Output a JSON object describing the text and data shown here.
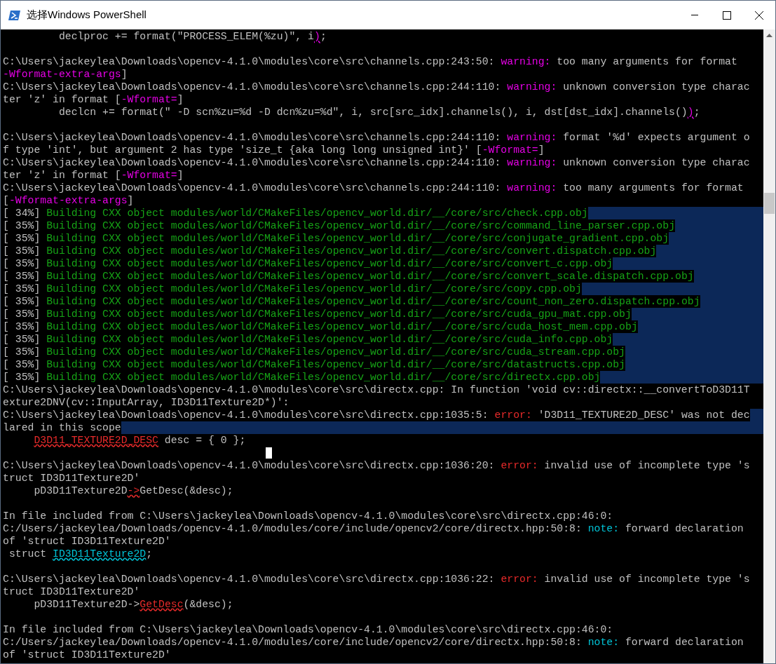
{
  "window": {
    "title": "选择Windows PowerShell"
  },
  "lines": [
    {
      "selected": false,
      "segments": [
        {
          "text": "         declproc += format(\"PROCESS_ELEM(%zu)\", i",
          "kind": "plain"
        },
        {
          "text": ")",
          "kind": "warn_mark"
        },
        {
          "text": ";",
          "kind": "plain"
        }
      ]
    },
    {
      "selected": false
    },
    {
      "selected": false,
      "segments": [
        {
          "text": "C:\\Users\\jackeylea\\Downloads\\opencv-4.1.0\\modules\\core\\src\\channels.cpp:243:50: ",
          "kind": "plain"
        },
        {
          "text": "warning:",
          "kind": "warning"
        },
        {
          "text": " too many arguments for format",
          "kind": "plain"
        }
      ]
    },
    {
      "selected": false,
      "segments": [
        {
          "text": "-Wformat-extra-args",
          "kind": "warning"
        },
        {
          "text": "]",
          "kind": "plain"
        }
      ]
    },
    {
      "selected": false,
      "segments": [
        {
          "text": "C:\\Users\\jackeylea\\Downloads\\opencv-4.1.0\\modules\\core\\src\\channels.cpp:244:110: ",
          "kind": "plain"
        },
        {
          "text": "warning:",
          "kind": "warning"
        },
        {
          "text": " unknown conversion type charac",
          "kind": "plain"
        }
      ]
    },
    {
      "selected": false,
      "segments": [
        {
          "text": "ter 'z' in format [",
          "kind": "plain"
        },
        {
          "text": "-Wformat=",
          "kind": "warning"
        },
        {
          "text": "]",
          "kind": "plain"
        }
      ]
    },
    {
      "selected": false,
      "segments": [
        {
          "text": "         declcn += format(\" -D scn%zu=%d -D dcn%zu=%d\", i, src[src_idx].channels(), i, dst[dst_idx].channels()",
          "kind": "plain"
        },
        {
          "text": ")",
          "kind": "warn_mark"
        },
        {
          "text": ";",
          "kind": "plain"
        }
      ]
    },
    {
      "selected": false
    },
    {
      "selected": false,
      "segments": [
        {
          "text": "C:\\Users\\jackeylea\\Downloads\\opencv-4.1.0\\modules\\core\\src\\channels.cpp:244:110: ",
          "kind": "plain"
        },
        {
          "text": "warning:",
          "kind": "warning"
        },
        {
          "text": " format '%d' expects argument o",
          "kind": "plain"
        }
      ]
    },
    {
      "selected": false,
      "segments": [
        {
          "text": "f type 'int', but argument 2 has type 'size_t {aka long long unsigned int}' [",
          "kind": "plain"
        },
        {
          "text": "-Wformat=",
          "kind": "warning"
        },
        {
          "text": "]",
          "kind": "plain"
        }
      ]
    },
    {
      "selected": false,
      "segments": [
        {
          "text": "C:\\Users\\jackeylea\\Downloads\\opencv-4.1.0\\modules\\core\\src\\channels.cpp:244:110: ",
          "kind": "plain"
        },
        {
          "text": "warning:",
          "kind": "warning"
        },
        {
          "text": " unknown conversion type charac",
          "kind": "plain"
        }
      ]
    },
    {
      "selected": false,
      "segments": [
        {
          "text": "ter 'z' in format [",
          "kind": "plain"
        },
        {
          "text": "-Wformat=",
          "kind": "warning"
        },
        {
          "text": "]",
          "kind": "plain"
        }
      ]
    },
    {
      "selected": false,
      "segments": [
        {
          "text": "C:\\Users\\jackeylea\\Downloads\\opencv-4.1.0\\modules\\core\\src\\channels.cpp:244:110: ",
          "kind": "plain"
        },
        {
          "text": "warning:",
          "kind": "warning"
        },
        {
          "text": " too many arguments for format",
          "kind": "plain"
        }
      ]
    },
    {
      "selected": false,
      "segments": [
        {
          "text": "[",
          "kind": "plain"
        },
        {
          "text": "-Wformat-extra-args",
          "kind": "warning"
        },
        {
          "text": "]",
          "kind": "plain"
        }
      ]
    },
    {
      "selected": true,
      "segments": [
        {
          "text": "[ 34%] ",
          "kind": "plain"
        },
        {
          "text": "Building CXX object modules/world/CMakeFiles/opencv_world.dir/__/core/src/check.cpp.obj",
          "kind": "build"
        }
      ]
    },
    {
      "selected": true,
      "segments": [
        {
          "text": "[ 35%] ",
          "kind": "plain"
        },
        {
          "text": "Building CXX object modules/world/CMakeFiles/opencv_world.dir/__/core/src/command_line_parser.cpp.obj",
          "kind": "build"
        }
      ]
    },
    {
      "selected": true,
      "segments": [
        {
          "text": "[ 35%] ",
          "kind": "plain"
        },
        {
          "text": "Building CXX object modules/world/CMakeFiles/opencv_world.dir/__/core/src/conjugate_gradient.cpp.obj",
          "kind": "build"
        }
      ]
    },
    {
      "selected": true,
      "segments": [
        {
          "text": "[ 35%] ",
          "kind": "plain"
        },
        {
          "text": "Building CXX object modules/world/CMakeFiles/opencv_world.dir/__/core/src/convert.dispatch.cpp.obj",
          "kind": "build"
        }
      ]
    },
    {
      "selected": true,
      "segments": [
        {
          "text": "[ 35%] ",
          "kind": "plain"
        },
        {
          "text": "Building CXX object modules/world/CMakeFiles/opencv_world.dir/__/core/src/convert_c.cpp.obj",
          "kind": "build"
        }
      ]
    },
    {
      "selected": true,
      "segments": [
        {
          "text": "[ 35%] ",
          "kind": "plain"
        },
        {
          "text": "Building CXX object modules/world/CMakeFiles/opencv_world.dir/__/core/src/convert_scale.dispatch.cpp.obj",
          "kind": "build"
        }
      ]
    },
    {
      "selected": true,
      "segments": [
        {
          "text": "[ 35%] ",
          "kind": "plain"
        },
        {
          "text": "Building CXX object modules/world/CMakeFiles/opencv_world.dir/__/core/src/copy.cpp.obj",
          "kind": "build"
        }
      ]
    },
    {
      "selected": true,
      "segments": [
        {
          "text": "[ 35%] ",
          "kind": "plain"
        },
        {
          "text": "Building CXX object modules/world/CMakeFiles/opencv_world.dir/__/core/src/count_non_zero.dispatch.cpp.obj",
          "kind": "build"
        }
      ]
    },
    {
      "selected": true,
      "segments": [
        {
          "text": "[ 35%] ",
          "kind": "plain"
        },
        {
          "text": "Building CXX object modules/world/CMakeFiles/opencv_world.dir/__/core/src/cuda_gpu_mat.cpp.obj",
          "kind": "build"
        }
      ]
    },
    {
      "selected": true,
      "segments": [
        {
          "text": "[ 35%] ",
          "kind": "plain"
        },
        {
          "text": "Building CXX object modules/world/CMakeFiles/opencv_world.dir/__/core/src/cuda_host_mem.cpp.obj",
          "kind": "build"
        }
      ]
    },
    {
      "selected": true,
      "segments": [
        {
          "text": "[ 35%] ",
          "kind": "plain"
        },
        {
          "text": "Building CXX object modules/world/CMakeFiles/opencv_world.dir/__/core/src/cuda_info.cpp.obj",
          "kind": "build"
        }
      ]
    },
    {
      "selected": true,
      "segments": [
        {
          "text": "[ 35%] ",
          "kind": "plain"
        },
        {
          "text": "Building CXX object modules/world/CMakeFiles/opencv_world.dir/__/core/src/cuda_stream.cpp.obj",
          "kind": "build"
        }
      ]
    },
    {
      "selected": true,
      "segments": [
        {
          "text": "[ 35%] ",
          "kind": "plain"
        },
        {
          "text": "Building CXX object modules/world/CMakeFiles/opencv_world.dir/__/core/src/datastructs.cpp.obj",
          "kind": "build"
        }
      ]
    },
    {
      "selected": true,
      "segments": [
        {
          "text": "[ 35%] ",
          "kind": "plain"
        },
        {
          "text": "Building CXX object modules/world/CMakeFiles/opencv_world.dir/__/core/src/directx.cpp.obj",
          "kind": "build"
        }
      ]
    },
    {
      "selected": false,
      "segments": [
        {
          "text": "C:\\Users\\jackeylea\\Downloads\\opencv-4.1.0\\modules\\core\\src\\directx.cpp: In function 'void cv::directx::__convertToD3D11T",
          "kind": "plain"
        }
      ]
    },
    {
      "selected": false,
      "segments": [
        {
          "text": "exture2DNV(cv::InputArray, ID3D11Texture2D*)':",
          "kind": "plain"
        }
      ]
    },
    {
      "selected": true,
      "segments": [
        {
          "text": "C:\\Users\\jackeylea\\Downloads\\opencv-4.1.0\\modules\\core\\src\\directx.cpp:1035:5: ",
          "kind": "plain"
        },
        {
          "text": "error:",
          "kind": "error"
        },
        {
          "text": " 'D3D11_TEXTURE2D_DESC' was not dec",
          "kind": "plain"
        }
      ]
    },
    {
      "selected": true,
      "segments": [
        {
          "text": "lared in this scope",
          "kind": "plain"
        }
      ]
    },
    {
      "selected": false,
      "indented": true,
      "segments": [
        {
          "text": "D3D11_TEXTURE2D_DESC",
          "kind": "err_mark"
        },
        {
          "text": " desc = { 0 };",
          "kind": "plain"
        }
      ]
    },
    {
      "selected": false,
      "cursor": true
    },
    {
      "selected": false,
      "segments": [
        {
          "text": "C:\\Users\\jackeylea\\Downloads\\opencv-4.1.0\\modules\\core\\src\\directx.cpp:1036:20: ",
          "kind": "plain"
        },
        {
          "text": "error:",
          "kind": "error"
        },
        {
          "text": " invalid use of incomplete type 's",
          "kind": "plain"
        }
      ]
    },
    {
      "selected": false,
      "segments": [
        {
          "text": "truct ID3D11Texture2D'",
          "kind": "plain"
        }
      ]
    },
    {
      "selected": false,
      "segments": [
        {
          "text": "     pD3D11Texture2D",
          "kind": "plain"
        },
        {
          "text": "->",
          "kind": "err_mark"
        },
        {
          "text": "GetDesc(&desc);",
          "kind": "plain"
        }
      ]
    },
    {
      "selected": false
    },
    {
      "selected": false,
      "segments": [
        {
          "text": "In file included from C:\\Users\\jackeylea\\Downloads\\opencv-4.1.0\\modules\\core\\src\\directx.cpp:46:0:",
          "kind": "plain"
        }
      ]
    },
    {
      "selected": false,
      "segments": [
        {
          "text": "C:/Users/jackeylea/Downloads/opencv-4.1.0/modules/core/include/opencv2/core/directx.hpp:50:8: ",
          "kind": "plain"
        },
        {
          "text": "note:",
          "kind": "note"
        },
        {
          "text": " forward declaration",
          "kind": "plain"
        }
      ]
    },
    {
      "selected": false,
      "segments": [
        {
          "text": "of 'struct ID3D11Texture2D'",
          "kind": "plain"
        }
      ]
    },
    {
      "selected": false,
      "segments": [
        {
          "text": " struct ",
          "kind": "plain"
        },
        {
          "text": "ID3D11Texture2D",
          "kind": "note_mark"
        },
        {
          "text": ";",
          "kind": "plain"
        }
      ]
    },
    {
      "selected": false
    },
    {
      "selected": false,
      "segments": [
        {
          "text": "C:\\Users\\jackeylea\\Downloads\\opencv-4.1.0\\modules\\core\\src\\directx.cpp:1036:22: ",
          "kind": "plain"
        },
        {
          "text": "error:",
          "kind": "error"
        },
        {
          "text": " invalid use of incomplete type 's",
          "kind": "plain"
        }
      ]
    },
    {
      "selected": false,
      "segments": [
        {
          "text": "truct ID3D11Texture2D'",
          "kind": "plain"
        }
      ]
    },
    {
      "selected": false,
      "segments": [
        {
          "text": "     pD3D11Texture2D->",
          "kind": "plain"
        },
        {
          "text": "GetDesc",
          "kind": "err_mark"
        },
        {
          "text": "(&desc);",
          "kind": "plain"
        }
      ]
    },
    {
      "selected": false
    },
    {
      "selected": false,
      "segments": [
        {
          "text": "In file included from C:\\Users\\jackeylea\\Downloads\\opencv-4.1.0\\modules\\core\\src\\directx.cpp:46:0:",
          "kind": "plain"
        }
      ]
    },
    {
      "selected": false,
      "segments": [
        {
          "text": "C:/Users/jackeylea/Downloads/opencv-4.1.0/modules/core/include/opencv2/core/directx.hpp:50:8: ",
          "kind": "plain"
        },
        {
          "text": "note:",
          "kind": "note"
        },
        {
          "text": " forward declaration",
          "kind": "plain"
        }
      ]
    },
    {
      "selected": false,
      "segments": [
        {
          "text": "of 'struct ID3D11Texture2D'",
          "kind": "plain"
        }
      ]
    }
  ]
}
